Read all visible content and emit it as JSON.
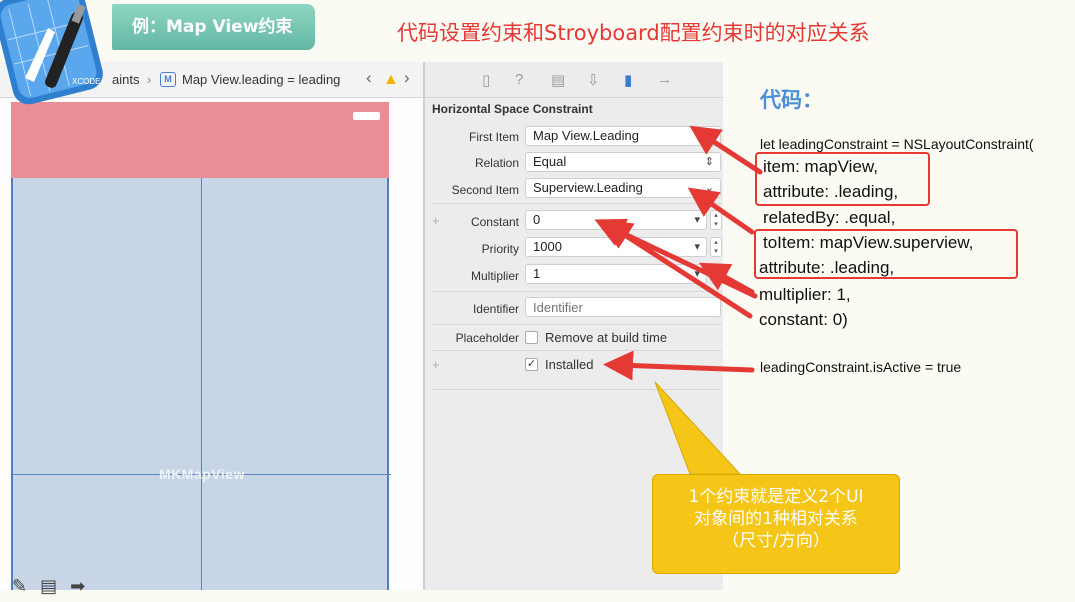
{
  "header": {
    "badge": "例：Map View约束",
    "title": "代码设置约束和Stroyboard配置约束时的对应关系"
  },
  "jumpbar": {
    "crumb": "aints",
    "icon": "M",
    "leaf": "Map View.leading = leading",
    "nav_left": "‹",
    "nav_right": "›",
    "warning": "▲"
  },
  "xcode_logo_text": "XCODE",
  "canvas": {
    "map_label": "MKMapView"
  },
  "inspector": {
    "tabs": [
      "▯",
      "?",
      "▤",
      "⇩",
      "▮",
      "→"
    ],
    "title": "Horizontal Space Constraint",
    "first_item_label": "First Item",
    "first_item_value": "Map View.Leading",
    "relation_label": "Relation",
    "relation_value": "Equal",
    "second_item_label": "Second Item",
    "second_item_value": "Superview.Leading",
    "constant_label": "Constant",
    "constant_value": "0",
    "priority_label": "Priority",
    "priority_value": "1000",
    "multiplier_label": "Multiplier",
    "multiplier_value": "1",
    "identifier_label": "Identifier",
    "identifier_placeholder": "Identifier",
    "placeholder_label": "Placeholder",
    "remove_label": "Remove at build time",
    "installed_label": "Installed",
    "plus": "+",
    "check": "✓"
  },
  "code": {
    "heading": "代码：",
    "line1": "let leadingConstraint = NSLayoutConstraint(",
    "line2": "item: mapView,",
    "line3": "attribute: .leading,",
    "line4": "relatedBy: .equal,",
    "line5": "toItem: mapView.superview,",
    "line6": "attribute: .leading,",
    "line7": "multiplier: 1,",
    "line8": "constant: 0)",
    "line9": "leadingConstraint.isActive = true"
  },
  "callout": {
    "line1": "1个约束就是定义2个UI",
    "line2": "对象间的1种相对关系",
    "line3": "（尺寸/方向）"
  },
  "tools": {
    "pen": "✎",
    "note": "▤",
    "arrow": "➡"
  },
  "colors": {
    "accent_red": "#e53935",
    "badge_teal": "#62b7a2",
    "code_heading_blue": "#4a90d9",
    "callout_yellow": "#f5c518",
    "statusbar_pink": "#e98e96",
    "mapview_blue": "#c7d5e7"
  }
}
